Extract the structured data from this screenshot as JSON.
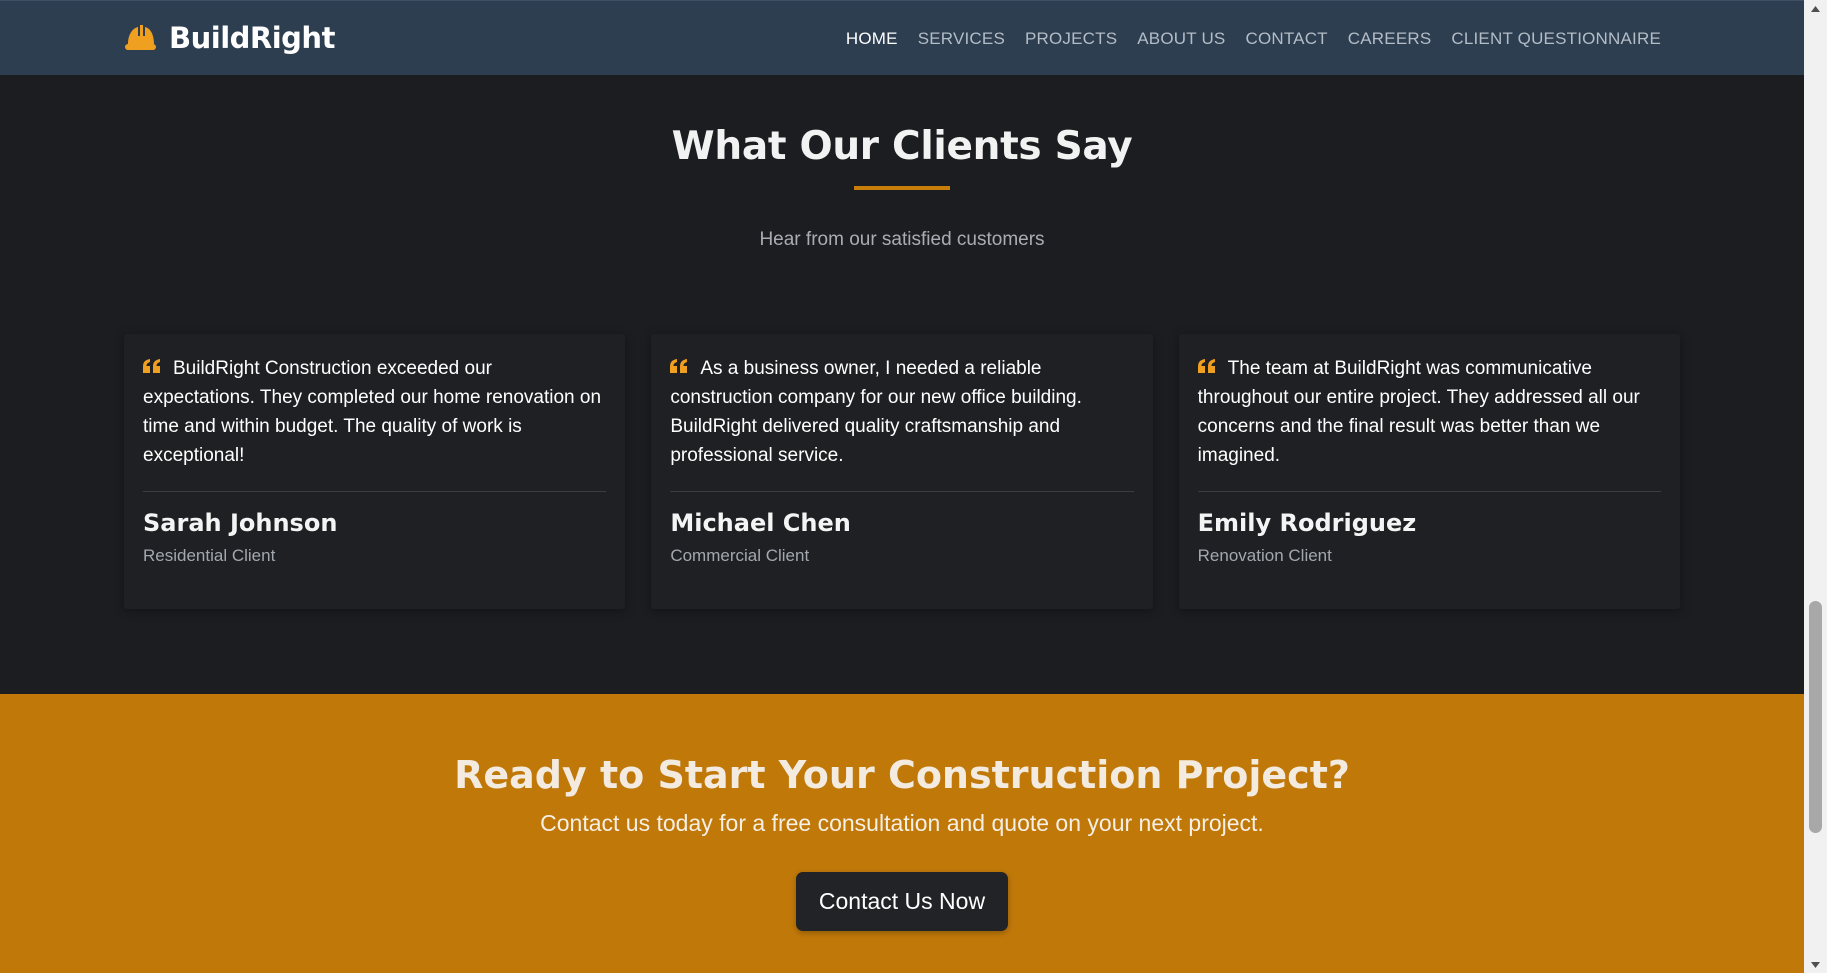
{
  "nav": {
    "brand": "BuildRight",
    "links": [
      {
        "label": "HOME",
        "active": true
      },
      {
        "label": "SERVICES",
        "active": false
      },
      {
        "label": "PROJECTS",
        "active": false
      },
      {
        "label": "ABOUT US",
        "active": false
      },
      {
        "label": "CONTACT",
        "active": false
      },
      {
        "label": "CAREERS",
        "active": false
      },
      {
        "label": "CLIENT QUESTIONNAIRE",
        "active": false
      }
    ]
  },
  "testimonials": {
    "title": "What Our Clients Say",
    "subtitle": "Hear from our satisfied customers",
    "items": [
      {
        "quote": "BuildRight Construction exceeded our expectations. They completed our home renovation on time and within budget. The quality of work is exceptional!",
        "name": "Sarah Johnson",
        "type": "Residential Client"
      },
      {
        "quote": "As a business owner, I needed a reliable construction company for our new office building. BuildRight delivered quality craftsmanship and professional service.",
        "name": "Michael Chen",
        "type": "Commercial Client"
      },
      {
        "quote": "The team at BuildRight was communicative throughout our entire project. They addressed all our concerns and the final result was better than we imagined.",
        "name": "Emily Rodriguez",
        "type": "Renovation Client"
      }
    ]
  },
  "cta": {
    "title": "Ready to Start Your Construction Project?",
    "text": "Contact us today for a free consultation and quote on your next project.",
    "button": "Contact Us Now"
  },
  "colors": {
    "nav_bg": "#2c3e50",
    "page_bg": "#1b1d20",
    "accent": "#c07809",
    "icon_accent": "#f0a020"
  },
  "icons": {
    "brand": "hard-hat-icon",
    "quote": "quote-left-icon"
  }
}
